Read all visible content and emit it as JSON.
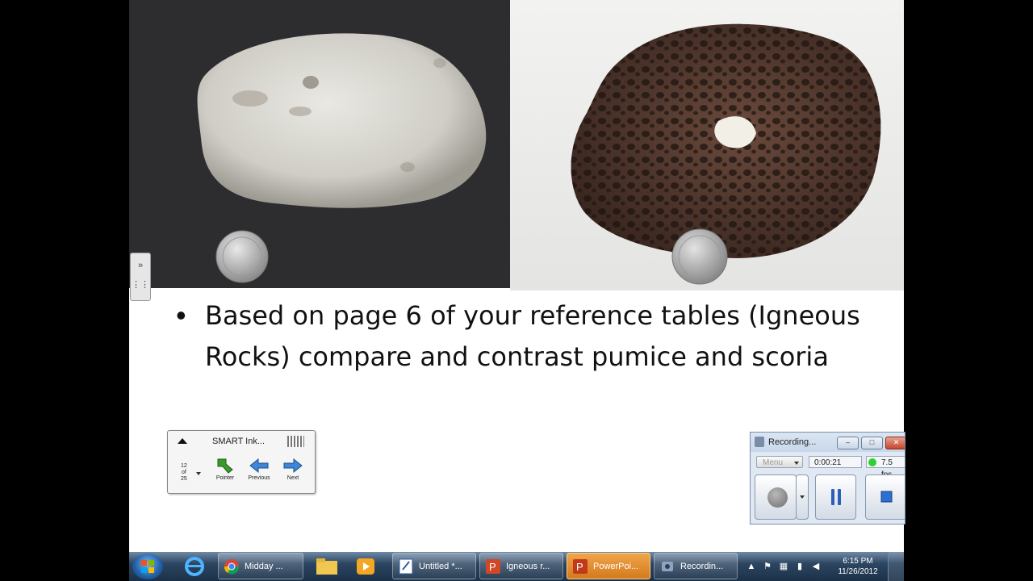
{
  "slide": {
    "bullet": "Based on page 6 of your reference tables (Igneous Rocks) compare and contrast pumice and scoria"
  },
  "smart_ink": {
    "title": "SMART Ink...",
    "page_num": "12",
    "page_of": "of",
    "page_total": "25",
    "pointer_label": "Pointer",
    "previous_label": "Previous",
    "next_label": "Next"
  },
  "recorder": {
    "title": "Recording...",
    "menu_label": "Menu",
    "elapsed": "0:00:21",
    "fps": "7.5 fps"
  },
  "taskbar": {
    "chrome_label": "Midday ...",
    "untitled_label": "Untitled *...",
    "igneous_label": "Igneous r...",
    "powerpoint_label": "PowerPoi...",
    "recording_label": "Recordin...",
    "time": "6:15 PM",
    "date": "11/26/2012"
  },
  "colors": {
    "taskbar_active": "#d37a1c",
    "record_status": "#2fd02f",
    "close_button": "#c7462c"
  }
}
